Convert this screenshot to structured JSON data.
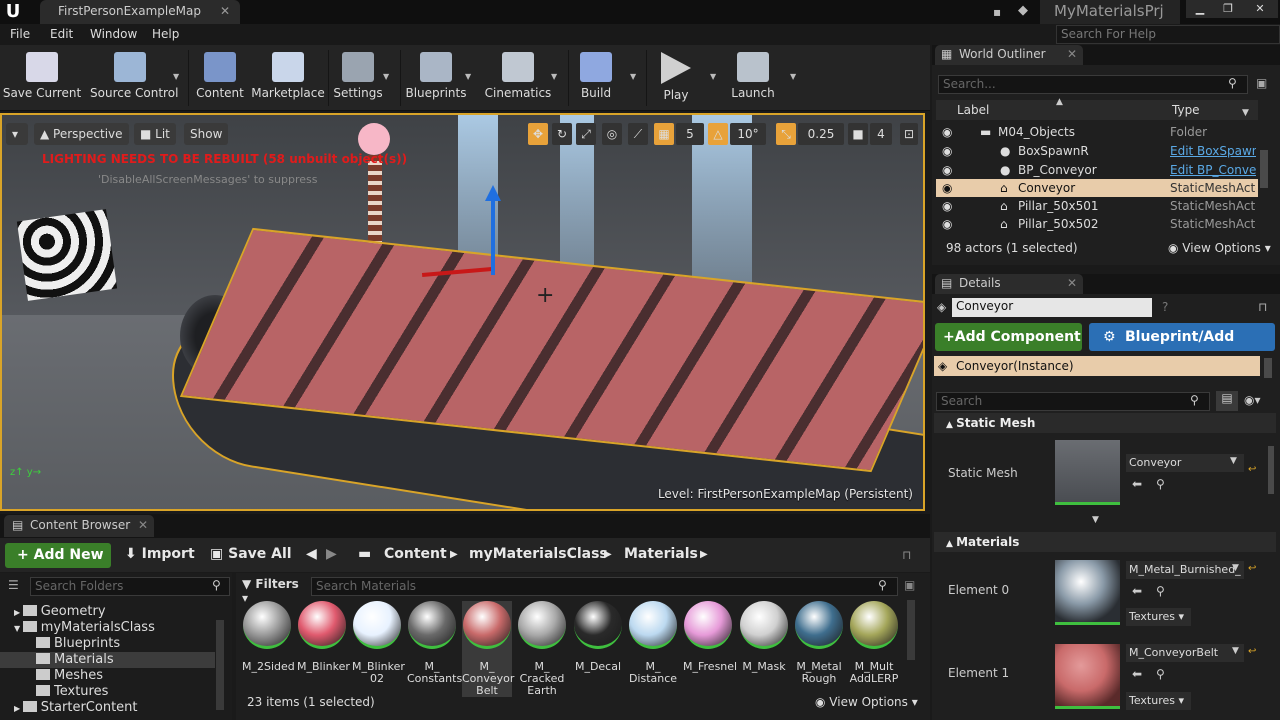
{
  "window": {
    "tab_title": "FirstPersonExampleMap",
    "project": "MyMaterialsPrj",
    "search_help": "Search For Help"
  },
  "menu": [
    "File",
    "Edit",
    "Window",
    "Help"
  ],
  "toolbar": [
    {
      "label": "Save Current",
      "icon": "save-icon"
    },
    {
      "label": "Source Control",
      "icon": "source-control-icon"
    },
    {
      "label": "Content",
      "icon": "content-icon"
    },
    {
      "label": "Marketplace",
      "icon": "marketplace-icon"
    },
    {
      "label": "Settings",
      "icon": "settings-icon"
    },
    {
      "label": "Blueprints",
      "icon": "blueprints-icon"
    },
    {
      "label": "Cinematics",
      "icon": "cinematics-icon"
    },
    {
      "label": "Build",
      "icon": "build-icon"
    },
    {
      "label": "Play",
      "icon": "play-icon"
    },
    {
      "label": "Launch",
      "icon": "launch-icon"
    }
  ],
  "viewport": {
    "perspective": "Perspective",
    "lit": "Lit",
    "show": "Show",
    "warning": "LIGHTING NEEDS TO BE REBUILT (58 unbuilt object(s))",
    "warning_sub": "'DisableAllScreenMessages' to suppress",
    "grid_snap": "5",
    "rot_snap": "10°",
    "scale_snap": "0.25",
    "cam_speed": "4",
    "level_label": "Level:",
    "level_name": "FirstPersonExampleMap (Persistent)"
  },
  "content_browser": {
    "tab": "Content Browser",
    "add_new": "Add New",
    "import": "Import",
    "save_all": "Save All",
    "breadcrumb": [
      "Content",
      "myMaterialsClass",
      "Materials"
    ],
    "search_folders": "Search Folders",
    "filters": "Filters",
    "search_materials": "Search Materials",
    "folders": [
      "Geometry",
      "myMaterialsClass",
      "Blueprints",
      "Materials",
      "Meshes",
      "Textures",
      "StarterContent"
    ],
    "assets": [
      {
        "name": "M_2Sided",
        "color": "#9a9a9a"
      },
      {
        "name": "M_Blinker",
        "color": "#e05a6e"
      },
      {
        "name": "M_Blinker\n02",
        "color": "#e8f2ff"
      },
      {
        "name": "M_\nConstants",
        "color": "#6a6a6a"
      },
      {
        "name": "M_\nConveyor\nBelt",
        "color": "#c96a6a"
      },
      {
        "name": "M_\nCracked\nEarth",
        "color": "#a9a9a9"
      },
      {
        "name": "M_Decal",
        "color": "#2a2a2a"
      },
      {
        "name": "M_\nDistance",
        "color": "#bcd9f0"
      },
      {
        "name": "M_Fresnel",
        "color": "#e69ad8"
      },
      {
        "name": "M_Mask",
        "color": "#d0d0d0"
      },
      {
        "name": "M_Metal\nRough",
        "color": "#3f6e8e"
      },
      {
        "name": "M_Mult\nAddLERP",
        "color": "#a4a65a"
      }
    ],
    "status": "23 items (1 selected)",
    "view_options": "View Options"
  },
  "outliner": {
    "tab": "World Outliner",
    "search": "Search...",
    "col_label": "Label",
    "col_type": "Type",
    "rows": [
      {
        "label": "M04_Objects",
        "type": "Folder"
      },
      {
        "label": "BoxSpawnR",
        "type": "Edit BoxSpawn"
      },
      {
        "label": "BP_Conveyor",
        "type": "Edit BP_Conve"
      },
      {
        "label": "Conveyor",
        "type": "StaticMeshActo"
      },
      {
        "label": "Pillar_50x501",
        "type": "StaticMeshActo"
      },
      {
        "label": "Pillar_50x502",
        "type": "StaticMeshActo"
      }
    ],
    "count": "98 actors (1 selected)",
    "view_options": "View Options"
  },
  "details": {
    "tab": "Details",
    "name": "Conveyor",
    "add_component": "Add Component",
    "blueprint_script": "Blueprint/Add Script",
    "component": "Conveyor(Instance)",
    "search": "Search",
    "static_mesh_section": "Static Mesh",
    "static_mesh_label": "Static Mesh",
    "static_mesh_value": "Conveyor",
    "materials_section": "Materials",
    "elements": [
      {
        "label": "Element 0",
        "value": "M_Metal_Burnished_",
        "textures": "Textures",
        "color": "#8a9aa8"
      },
      {
        "label": "Element 1",
        "value": "M_ConveyorBelt",
        "textures": "Textures",
        "color": "#c96a6a"
      }
    ]
  },
  "colors": {
    "accent_green": "#3a7f29",
    "accent_blue": "#2b6fb5",
    "selection": "#e8ccaa",
    "viewport_border": "#d9a428"
  }
}
